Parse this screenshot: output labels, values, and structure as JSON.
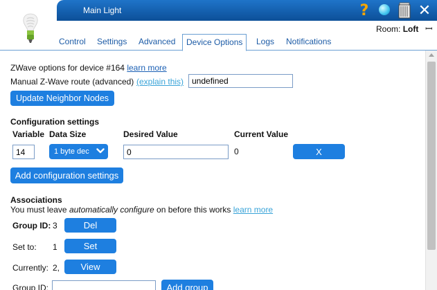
{
  "window": {
    "title": "Main Light"
  },
  "header": {
    "room_label": "Room:",
    "room_value": "Loft",
    "room_toggle": "ꟷ"
  },
  "tabs": [
    {
      "label": "Control"
    },
    {
      "label": "Settings"
    },
    {
      "label": "Advanced"
    },
    {
      "label": "Device Options",
      "active": true
    },
    {
      "label": "Logs"
    },
    {
      "label": "Notifications"
    }
  ],
  "zwave": {
    "options_text": "ZWave options for device #164",
    "learn_more": "learn more",
    "route_label": "Manual Z-Wave route (advanced)",
    "explain_link": "(explain this)",
    "route_value": "undefined",
    "update_button": "Update Neighbor Nodes"
  },
  "config": {
    "heading": "Configuration settings",
    "col_variable": "Variable",
    "col_data_size": "Data Size",
    "col_desired": "Desired Value",
    "col_current": "Current Value",
    "variable_value": "14",
    "data_size_selected": "1 byte dec",
    "desired_value": "0",
    "current_value": "0",
    "remove_button": "X",
    "add_button": "Add configuration settings"
  },
  "associations": {
    "heading": "Associations",
    "note_prefix": "You must leave ",
    "note_emph": "automatically configure",
    "note_suffix": " on before this works",
    "learn_more": "learn more",
    "group_id_label": "Group ID:",
    "group_id_value": "3",
    "del_button": "Del",
    "set_to_label": "Set to:",
    "set_to_value": "1",
    "set_button": "Set",
    "currently_label": "Currently:",
    "currently_value": "2,",
    "view_button": "View",
    "new_group_label": "Group ID:",
    "new_group_value": "",
    "add_group_button": "Add group"
  },
  "icons": [
    "bulb-icon",
    "help-icon",
    "drop-icon",
    "trash-icon",
    "close-icon",
    "chevron-down-icon",
    "scroll-up-icon"
  ],
  "colors": {
    "titlebar": "#0c4f98",
    "button": "#1e7fe0",
    "link": "#1a5fb4",
    "help": "#f5a500"
  }
}
